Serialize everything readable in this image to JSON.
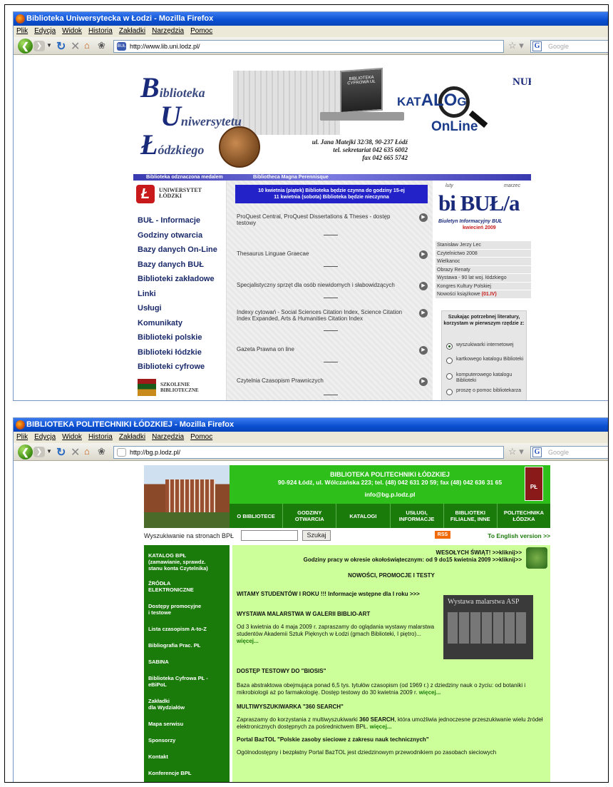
{
  "s1": {
    "window_title": "Biblioteka Uniwersytecka w Łodzi - Mozilla Firefox",
    "menu": [
      "Plik",
      "Edycja",
      "Widok",
      "Historia",
      "Zakładki",
      "Narzędzia",
      "Pomoc"
    ],
    "url": "http://www.lib.uni.lodz.pl/",
    "search_placeholder": "Google",
    "banner": {
      "b": "B",
      "b_rest": "iblioteka",
      "u": "U",
      "u_rest": "niwersytetu",
      "l": "Ł",
      "l_rest": "ódzkiego",
      "cyfrowa": "BIBLIOTEKA CYFROWA UŁ",
      "address1": "ul. Jana Matejki 32/38, 90-237 Łódź",
      "address2": "tel. sekretariat 042 635 6002",
      "address3": "fax 042 665 5742",
      "katalog_a": "KAT",
      "katalog_b": "ALO",
      "katalog_c": "G",
      "online": "OnLine",
      "nukat": "NUKAT",
      "medal_text": "Biblioteka odznaczona medalem",
      "magna": "Bibliotheca Magna Perennisque"
    },
    "ul_logo": "Ł",
    "ul_name": "UNIWERSYTET\nŁÓDZKI",
    "nav": [
      "BUŁ - Informacje",
      "Godziny otwarcia",
      "Bazy danych On-Line",
      "Bazy danych BUŁ",
      "Biblioteki zakładowe",
      "Linki",
      "Usługi",
      "Komunikaty",
      "Biblioteki polskie",
      "Biblioteki łódzkie",
      "Biblioteki cyfrowe"
    ],
    "szkolenie": "SZKOLENIE\nBIBLIOTECZNE",
    "notice": "10 kwietnia (piątek) Biblioteka będzie czynna do godziny 15-ej\n11 kwietnia (sobota) Biblioteka będzie nieczynna",
    "news": [
      "ProQuest Central, ProQuest Dissertations & Theses - dostęp testowy",
      "Thesaurus Linguae Graecae",
      "Specjalistyczny sprzęt dla osób niewidomych i słabowidzących",
      "Indexy cytowań - Social Sciences Citation Index, Science Citation Index Expanded, Arts & Humanities Citation Index",
      "Gazeta Prawna on line",
      "Czytelnia Czasopism Prawniczych"
    ],
    "bibul": {
      "luty": "luty",
      "marzec": "marzec",
      "title": "bi BUŁ/a",
      "subtitle": "Biuletyn Informacyjny BUŁ",
      "issue": "kwiecień 2009"
    },
    "right_list": [
      "Stanisław Jerzy Lec",
      "Czytelnictwo 2008",
      "Wielkanoc",
      "Obrazy Renaty",
      "Wystawa - 90 lat woj. łódzkiego",
      "Kongres Kultury Polskiej"
    ],
    "right_last": "Nowości książkowe",
    "right_last_date": "(01.IV)",
    "survey_q": "Szukając potrzebnej literatury, korzystam w pierwszym rzędzie z:",
    "survey_opts": [
      "wyszukiwarki internetowej",
      "kartkowego katalogu Biblioteki",
      "komputerowego katalogu Biblioteki",
      "proszę o pomoc bibliotekarza"
    ]
  },
  "s2": {
    "window_title": "BIBLIOTEKA POLITECHNIKI ŁÓDZKIEJ - Mozilla Firefox",
    "menu": [
      "Plik",
      "Edycja",
      "Widok",
      "Historia",
      "Zakładki",
      "Narzędzia",
      "Pomoc"
    ],
    "url": "http://bg.p.lodz.pl/",
    "search_placeholder": "Google",
    "head1": "BIBLIOTEKA POLITECHNIKI ŁÓDZKIEJ",
    "head2": "90-924 Łódź, ul. Wólczańska 223; tel. (48) 042 631 20 59; fax (48) 042 636 31 65",
    "email": "info@bg.p.lodz.pl",
    "crest": "PŁ",
    "nav": [
      "O BIBLIOTECE",
      "GODZINY\nOTWARCIA",
      "KATALOGI",
      "USŁUGI,\nINFORMACJE",
      "BIBLIOTEKI\nFILIALNE, INNE",
      "POLITECHNIKA\nŁÓDZKA"
    ],
    "search_label": "Wyszukiwanie na stronach BPŁ",
    "search_btn": "Szukaj",
    "rss": "RSS",
    "english": "To English version >>",
    "left": [
      "KATALOG BPŁ\n(zamawianie, sprawdz.\nstanu konta Czytelnika)",
      "ŹRÓDŁA\nELEKTRONICZNE",
      "Dostępy promocyjne\ni testowe",
      "Lista czasopism A-to-Z",
      "Bibliografia Prac. PŁ",
      "SABINA",
      "Biblioteka Cyfrowa PŁ -\neBiPoL",
      "Zakładki\ndla Wydziałów",
      "Mapa serwisu",
      "Sponsorzy",
      "Kontakt",
      "Konferencje BPŁ"
    ],
    "wesolych": "WESOŁYCH ŚWIĄT! >>kliknij>>",
    "godziny": "Godziny pracy w okresie okołoświątecznym: od 9 do15 kwietnia 2009 >>kliknij>>",
    "nowosci": "NOWOŚCI, PROMOCJE I TESTY",
    "witamy": "WITAMY STUDENTÓW I ROKU !!!  Informacje wstępne dla I roku >>>",
    "wystawa_h": "WYSTAWA MALARSTWA W GALERII BIBLIO-ART",
    "wystawa_p": "Od 3 kwietnia do 4 maja 2009 r. zapraszamy do oglądania wystawy malarstwa studentów Akademii Sztuk Pięknych w Łodzi (gmach Biblioteki, I piętro)...",
    "wiecej": "więcej...",
    "exh_title": "Wystawa malarstwa ASP",
    "biosis_h": "DOSTĘP TESTOWY DO \"BIOSIS\"",
    "biosis_p": "Baza abstraktowa obejmująca ponad 6,5 tys. tytułów czasopism (od 1969 r.) z dziedziny nauk o życiu: od botaniki i mikrobiologii aż po farmakologię. Dostęp testowy do 30 kwietnia 2009 r.",
    "multi_h": "MULTIWYSZUKIWARKA \"360 SEARCH\"",
    "multi_p1": "Zapraszamy do korzystania z multiwyszukiwarki ",
    "multi_bold": "360 SEARCH",
    "multi_p2": ", która umożliwia jednoczesne przeszukiwanie wielu źródeł elektronicznych dostępnych za pośrednictwem BPŁ.",
    "baztol_h": "Portal BazTOL \"Polskie zasoby sieciowe z zakresu nauk technicznych\"",
    "baztol_p": "Ogólnodostępny i bezpłatny Portal BazTOL jest dziedzinowym przewodnikiem po zasobach sieciowych"
  }
}
